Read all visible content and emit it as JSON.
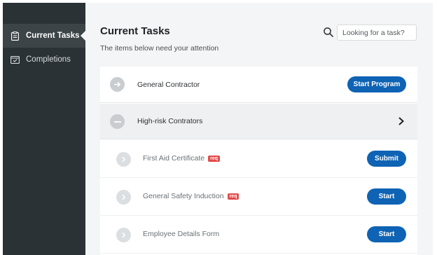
{
  "sidebar": {
    "items": [
      {
        "label": "Current Tasks",
        "icon": "clipboard-icon",
        "active": true
      },
      {
        "label": "Completions",
        "icon": "calendar-check-icon",
        "active": false
      }
    ]
  },
  "header": {
    "title": "Current Tasks",
    "subtitle": "The items below need your attention"
  },
  "search": {
    "placeholder": "Looking for a task?",
    "icon": "search-icon"
  },
  "tasks": {
    "program": {
      "label": "General Contractor",
      "button": "Start Program",
      "icon": "arrow-right-icon"
    },
    "group": {
      "label": "High-risk Contrators",
      "icon": "minus-icon",
      "expand_icon": "chevron-right-icon"
    },
    "items": [
      {
        "label": "First Aid Certificate",
        "badge": "req",
        "button": "Submit"
      },
      {
        "label": "General Safety Induction",
        "badge": "req",
        "button": "Start"
      },
      {
        "label": "Employee Details Form",
        "badge": "",
        "button": "Start"
      }
    ]
  },
  "colors": {
    "sidebar_bg": "#2b3236",
    "sidebar_active": "#3d4448",
    "primary_button": "#0e63b4",
    "badge_red": "#e34b4b",
    "content_bg": "#f4f5f6"
  }
}
